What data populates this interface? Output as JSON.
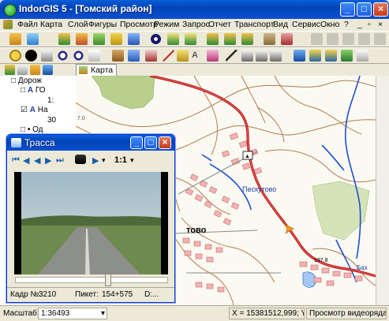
{
  "window": {
    "title": "IndorGIS 5 - [Томский район]",
    "controls": {
      "minimize": "_",
      "maximize": "□",
      "close": "×"
    }
  },
  "menu": {
    "items": [
      "Файл",
      "Карта",
      "Слой",
      "Фигуры",
      "Просмотр",
      "Режим",
      "Запрос",
      "Отчет",
      "Транспорт",
      "Вид",
      "Сервис",
      "Окно",
      "?"
    ],
    "doc_controls": [
      "_",
      "▫",
      "×"
    ]
  },
  "map_tab": {
    "label": "Карта"
  },
  "layer_tree": {
    "rows": [
      {
        "mark": "□",
        "label": "Дорож"
      },
      {
        "mark": "□",
        "label": "ГО"
      },
      {
        "mark": "",
        "label": "1:"
      },
      {
        "mark": "☑",
        "label": "На"
      },
      {
        "mark": "",
        "label": "30"
      },
      {
        "mark": "□",
        "label": "Од"
      }
    ]
  },
  "map": {
    "labels": {
      "village": "Пеcкутово",
      "town_fragment": "тово",
      "mark_fragment": "7.0",
      "road_number": "197.8",
      "edge_fragment": "Бах"
    }
  },
  "video_window": {
    "title": "Трасса",
    "zoom_label": "1:1",
    "frame_label": "Кадр №:",
    "frame_value": "3210",
    "picket_label": "Пикет:",
    "picket_value": "154+575",
    "extra_label": "D:..."
  },
  "status_bar": {
    "scale_label": "Масштаб:",
    "scale_value": "1:36493",
    "coords": "X = 15381512,999; Y = ...",
    "mode": "Просмотр видеоряда"
  },
  "colors": {
    "title_blue": "#0a50d0",
    "road_red": "#c01818",
    "contour_brown": "#b5794a",
    "river_blue": "#1e4fd0",
    "forest_green": "#b8cf8e",
    "building_pink": "#f3b3b3"
  }
}
